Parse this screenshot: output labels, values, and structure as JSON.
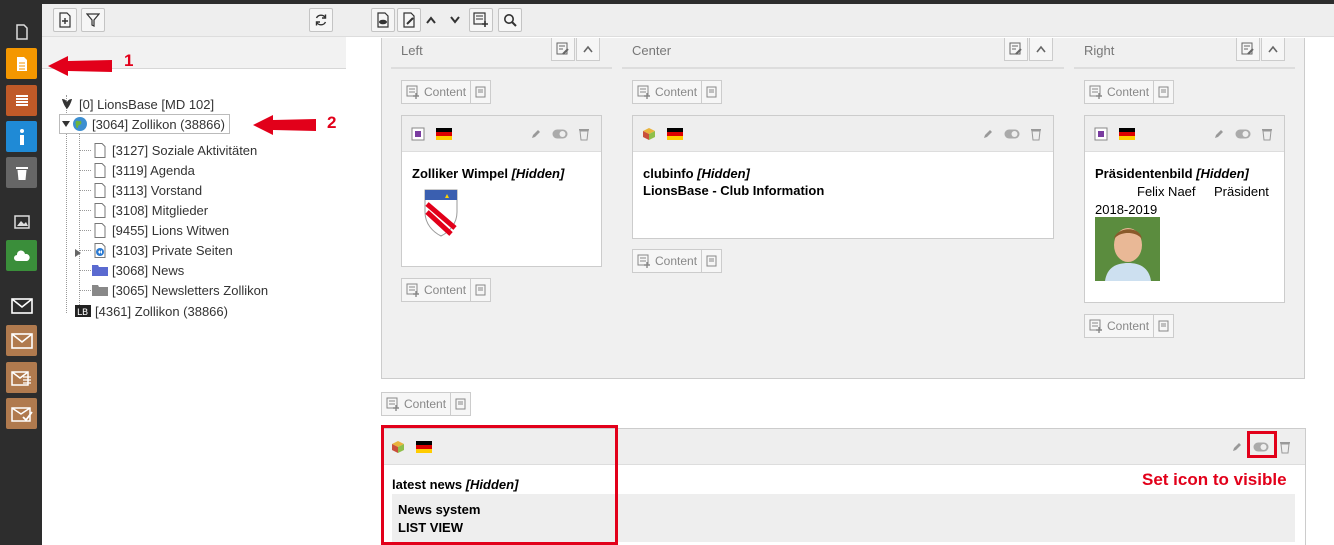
{
  "tree_toolbar": {
    "new_page_icon": "new-page-icon",
    "filter_icon": "filter-icon",
    "refresh_icon": "refresh-icon"
  },
  "doc_toolbar": {
    "icons": [
      "view-page-icon",
      "edit-page-icon",
      "move-up-icon",
      "move-down-icon",
      "new-content-icon",
      "search-icon"
    ]
  },
  "module_menu": [
    "document-icon",
    "page-icon",
    "list-icon",
    "info-icon",
    "trash-icon",
    "image-icon",
    "cloud-icon",
    "mail-icon",
    "mail-icon",
    "newsletter-icon",
    "mail-check-icon"
  ],
  "tree": {
    "root": "[0] LionsBase [MD 102]",
    "selected": "[3064] Zollikon (38866)",
    "children": [
      "[3127] Soziale Aktivitäten",
      "[3119] Agenda",
      "[3113] Vorstand",
      "[3108] Mitglieder",
      "[9455] Lions Witwen",
      "[3103] Private Seiten",
      "[3068] News",
      "[3065] Newsletters Zollikon"
    ],
    "other": "[4361] Zollikon (38866)"
  },
  "annotations": {
    "one": "1",
    "two": "2",
    "visible": "Set icon to visible"
  },
  "columns": {
    "left": "Left",
    "center": "Center",
    "right": "Right"
  },
  "content_button": "Content",
  "cards": {
    "left": {
      "title": "Zolliker Wimpel",
      "status": "[Hidden]"
    },
    "center": {
      "title": "clubinfo",
      "status": "[Hidden]",
      "body": "LionsBase - Club Information"
    },
    "right": {
      "title": "Präsidentenbild",
      "status": "[Hidden]",
      "name": "Felix Naef",
      "role": "Präsident",
      "years": "2018-2019"
    },
    "bottom": {
      "title": "latest news",
      "status": "[Hidden]",
      "line1": "News system",
      "line2": "LIST VIEW"
    }
  },
  "colors": {
    "accent": "#e2001a",
    "module_active": "#f49700"
  }
}
